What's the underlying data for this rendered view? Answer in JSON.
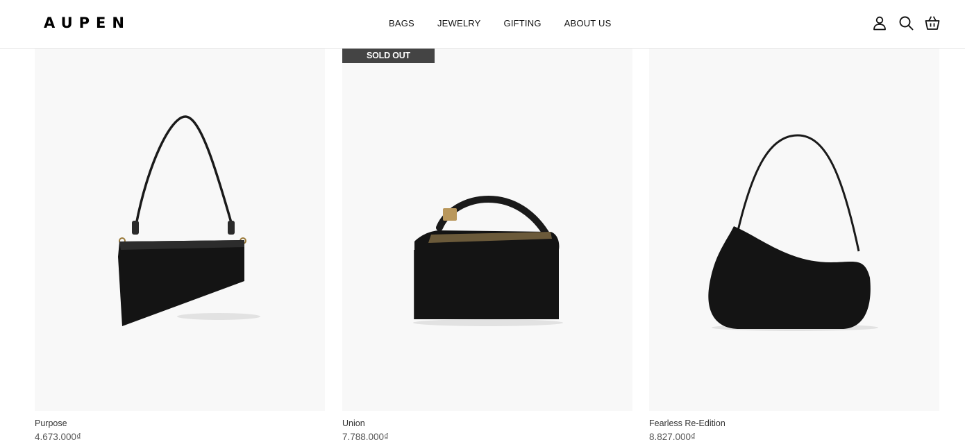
{
  "header": {
    "logo": "AUPEN",
    "nav": [
      {
        "label": "BAGS"
      },
      {
        "label": "JEWELRY"
      },
      {
        "label": "GIFTING"
      },
      {
        "label": "ABOUT US"
      }
    ],
    "icons": [
      "account-icon",
      "search-icon",
      "cart-icon"
    ]
  },
  "products": [
    {
      "name": "Purpose",
      "price": "4.673.000₫",
      "badge": ""
    },
    {
      "name": "Union",
      "price": "7.788.000₫",
      "badge": "SOLD OUT"
    },
    {
      "name": "Fearless Re-Edition",
      "price": "8.827.000₫",
      "badge": ""
    }
  ],
  "colors": {
    "badge_bg": "#444444",
    "image_bg": "#f8f8f8",
    "bag": "#141414"
  }
}
